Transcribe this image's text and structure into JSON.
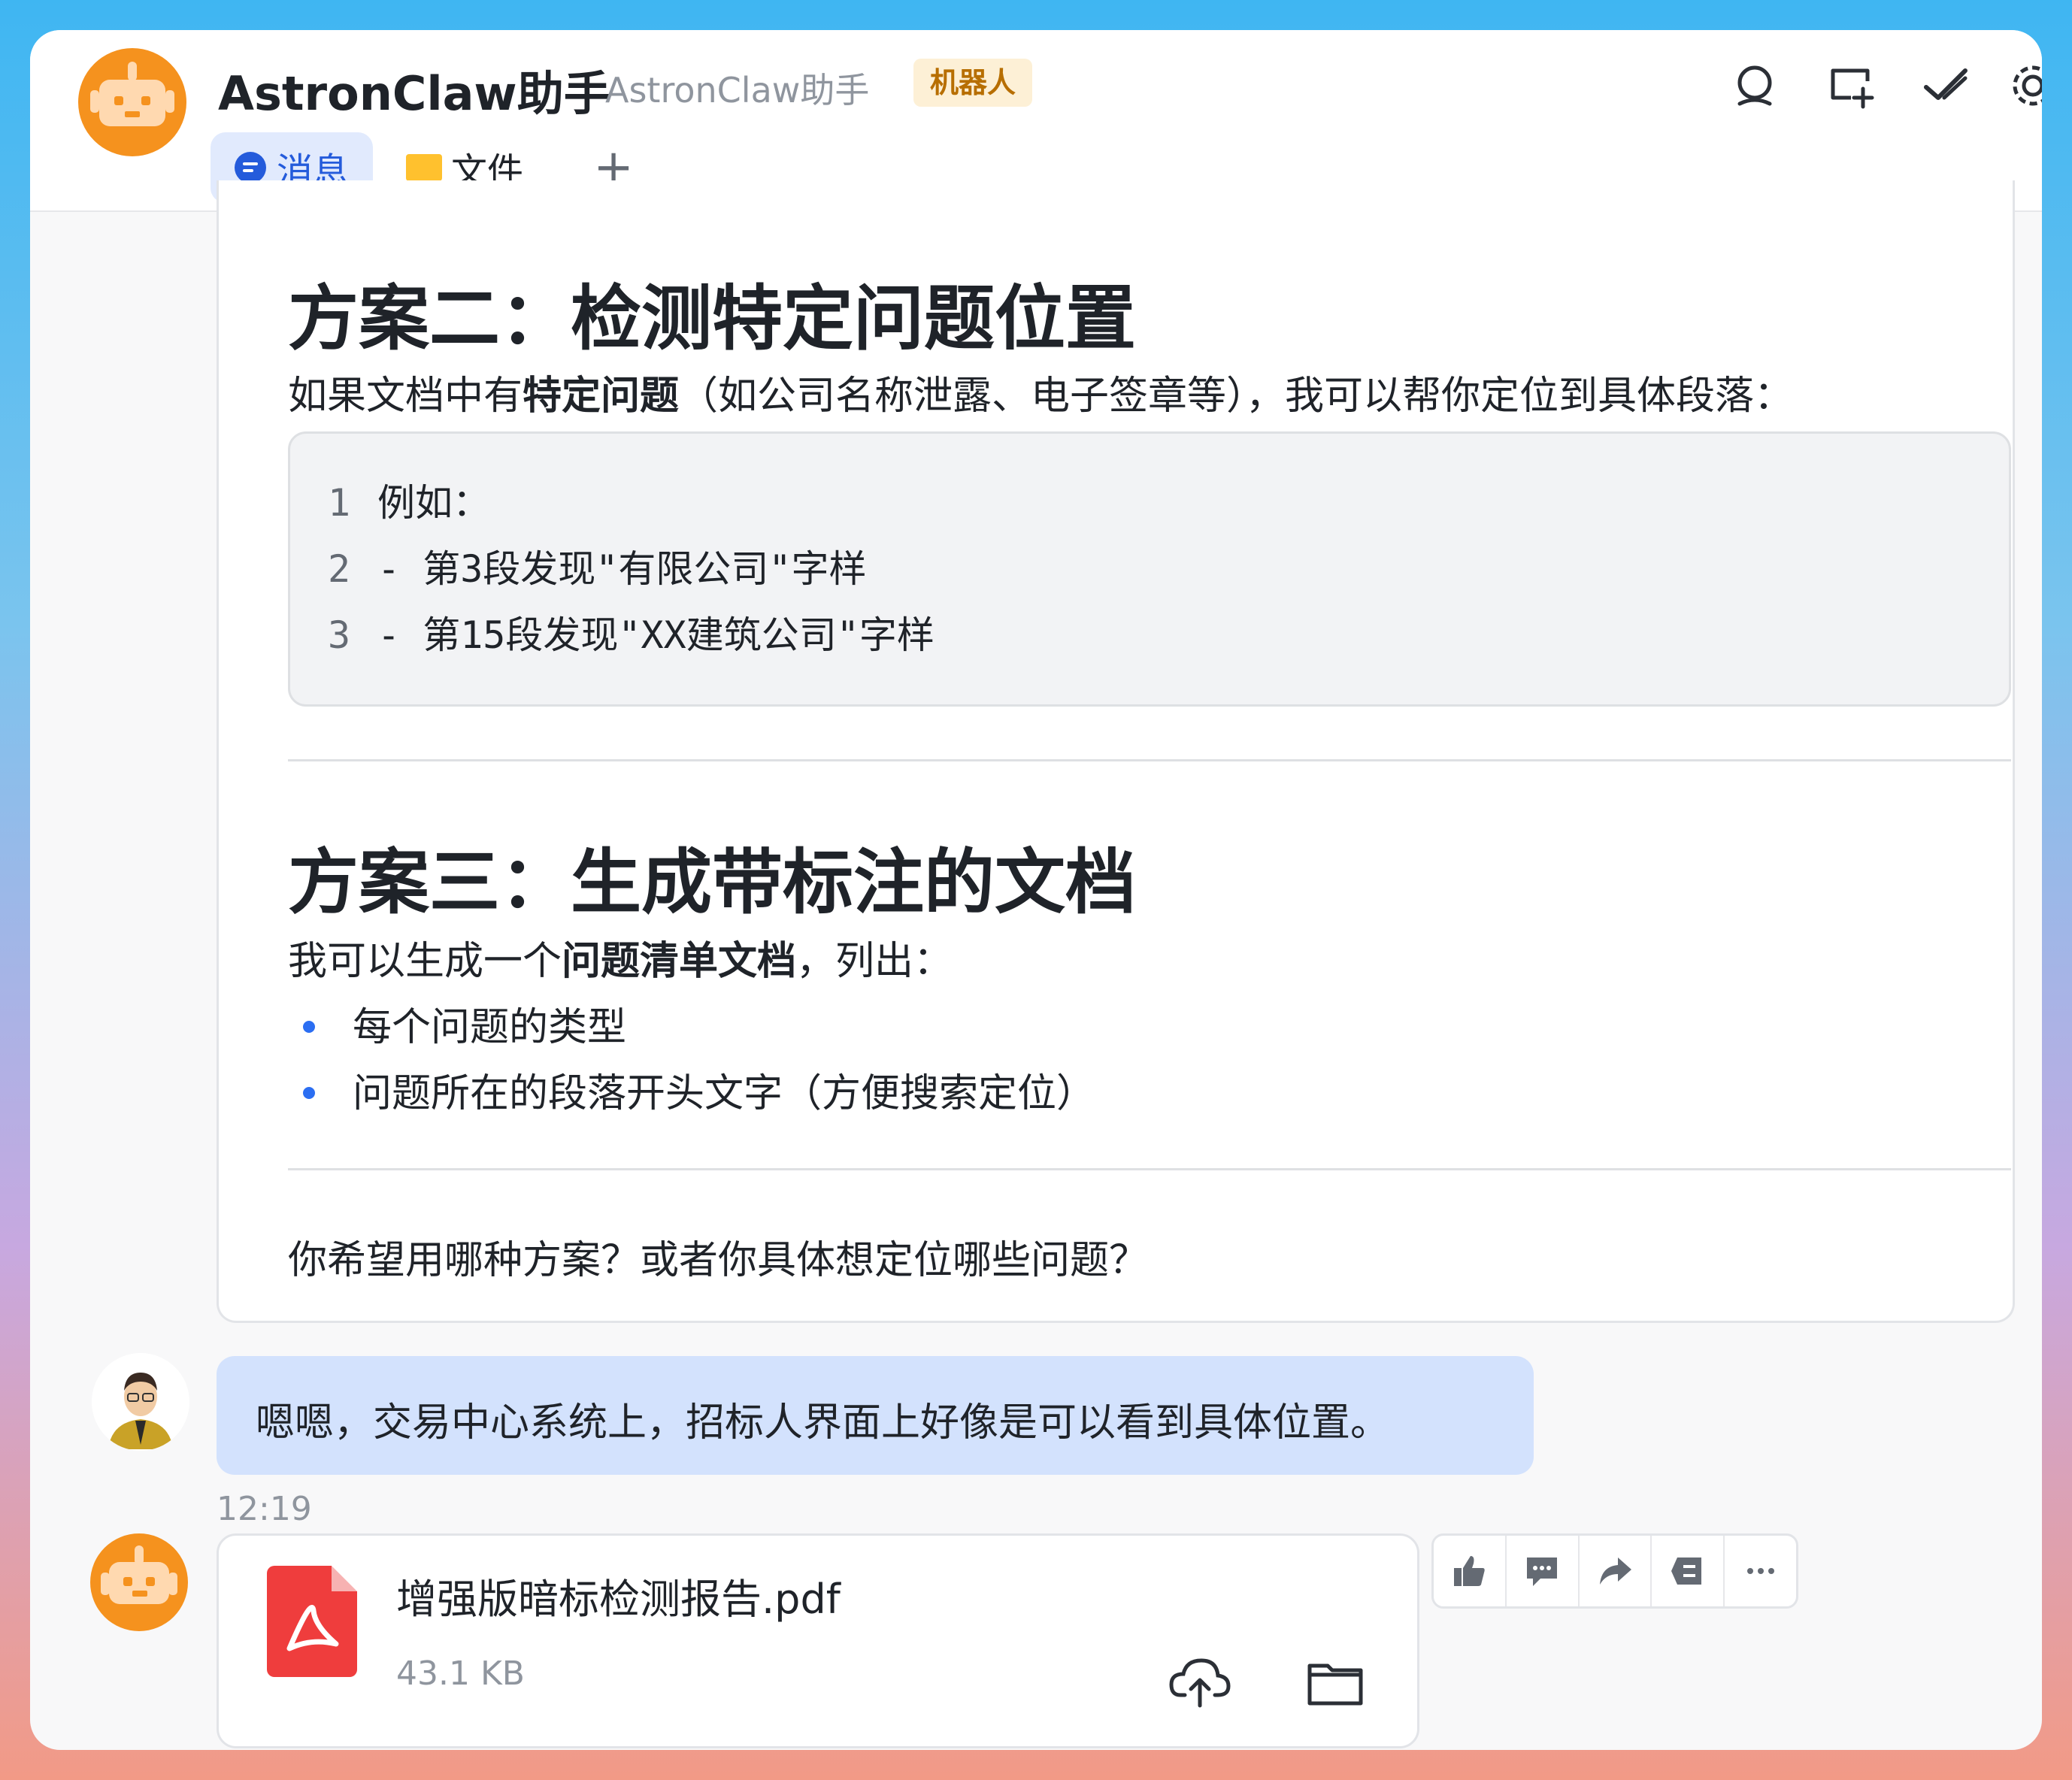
{
  "header": {
    "title": "AstronClaw助手",
    "subtitle": "AstronClaw助手",
    "badge": "机器人",
    "tabs": [
      {
        "label": "消息",
        "icon": "chat-bubble-icon",
        "active": true
      },
      {
        "label": "文件",
        "icon": "folder-icon",
        "active": false
      },
      {
        "label": "+",
        "icon": "add-icon",
        "active": false
      }
    ],
    "icons": [
      "search-icon",
      "new-chat-icon",
      "check-icon",
      "settings-icon"
    ]
  },
  "message": {
    "section2": {
      "heading": "方案二：检测特定问题位置",
      "intro_pre": "如果文档中有",
      "intro_bold": "特定问题",
      "intro_post": "（如公司名称泄露、电子签章等），我可以帮你定位到具体段落：",
      "code_lines": [
        {
          "num": "1",
          "text": "例如："
        },
        {
          "num": "2",
          "text": "- 第3段发现\"有限公司\"字样"
        },
        {
          "num": "3",
          "text": "- 第15段发现\"XX建筑公司\"字样"
        }
      ]
    },
    "section3": {
      "heading": "方案三：生成带标注的文档",
      "intro_pre": "我可以生成一个",
      "intro_bold": "问题清单文档",
      "intro_post": "，列出：",
      "bullets": [
        "每个问题的类型",
        "问题所在的段落开头文字（方便搜索定位）"
      ]
    },
    "question": "你希望用哪种方案？或者你具体想定位哪些问题？"
  },
  "user_message": {
    "text": "嗯嗯，交易中心系统上，招标人界面上好像是可以看到具体位置。",
    "time": "12:19"
  },
  "file_message": {
    "name": "增强版暗标检测报告.pdf",
    "size": "43.1 KB",
    "icons": [
      "pdf-file-icon",
      "cloud-upload-icon",
      "open-folder-icon"
    ]
  },
  "message_actions": [
    "thumbs-up-icon",
    "comment-icon",
    "forward-icon",
    "quote-icon",
    "more-icon"
  ],
  "colors": {
    "accent": "#245bdb",
    "bot_avatar": "#f5921e",
    "user_bubble": "#d3e2fd",
    "badge_bg": "#fdf0d6",
    "pdf_red": "#ef3d3d"
  }
}
